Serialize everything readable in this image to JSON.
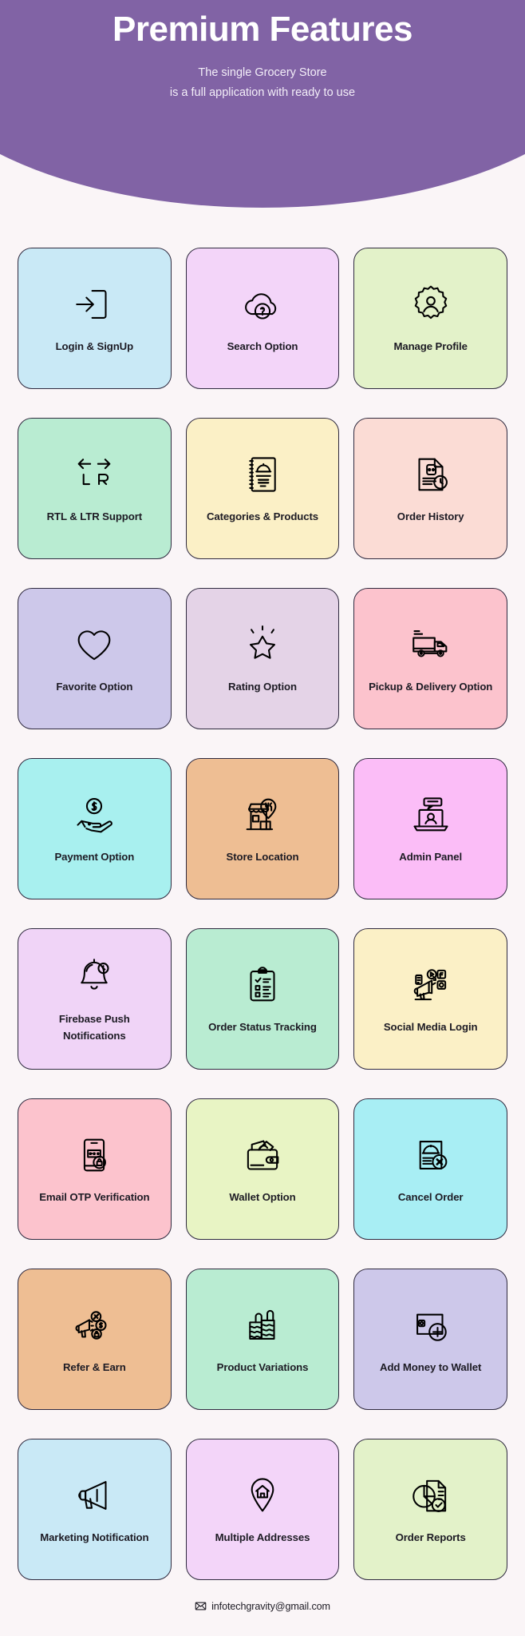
{
  "header": {
    "title": "Premium Features",
    "subtitle_line1": "The single Grocery Store",
    "subtitle_line2": "is a full application with ready to use",
    "background_color": "#8163a5",
    "text_color": "#ffffff"
  },
  "page": {
    "background_color": "#faf5f7",
    "card_border_color": "#2f2a3f",
    "icon_color": "#000000"
  },
  "features": [
    {
      "label": "Login & SignUp",
      "icon": "login-arrow-door-icon",
      "color": "#c9e9f6"
    },
    {
      "label": "Search Option",
      "icon": "cloud-search-icon",
      "color": "#f3d5f9"
    },
    {
      "label": "Manage Profile",
      "icon": "gear-user-profile-icon",
      "color": "#e3f2c9"
    },
    {
      "label": "RTL & LTR Support",
      "icon": "left-right-arrows-icon",
      "color": "#b9ecd2"
    },
    {
      "label": "Categories & Products",
      "icon": "menu-book-cloche-icon",
      "color": "#fbf0c6"
    },
    {
      "label": "Order History",
      "icon": "document-clock-history-icon",
      "color": "#fbdcd5"
    },
    {
      "label": "Favorite Option",
      "icon": "heart-icon",
      "color": "#cdc8ea"
    },
    {
      "label": "Rating Option",
      "icon": "star-sparkle-icon",
      "color": "#e4d3e7"
    },
    {
      "label": "Pickup & Delivery Option",
      "icon": "delivery-truck-icon",
      "color": "#fcc3cd"
    },
    {
      "label": "Payment Option",
      "icon": "hand-dollar-coin-icon",
      "color": "#a8f0ef"
    },
    {
      "label": "Store Location",
      "icon": "store-map-pin-icon",
      "color": "#eebe93"
    },
    {
      "label": "Admin Panel",
      "icon": "laptop-admin-user-icon",
      "color": "#fbbdf7"
    },
    {
      "label": "Firebase  Push Notifications",
      "icon": "bell-notification-icon",
      "color": "#f0d4f7"
    },
    {
      "label": "Order Status Tracking",
      "icon": "clipboard-checklist-icon",
      "color": "#b9ecd2"
    },
    {
      "label": "Social Media Login",
      "icon": "megaphone-social-icons",
      "color": "#fbf0c6"
    },
    {
      "label": "Email OTP Verification",
      "icon": "phone-otp-lock-icon",
      "color": "#fcc3cd"
    },
    {
      "label": "Wallet Option",
      "icon": "wallet-cash-icon",
      "color": "#e8f4c4"
    },
    {
      "label": "Cancel Order",
      "icon": "order-cancel-cross-icon",
      "color": "#a8eef4"
    },
    {
      "label": "Refer & Earn",
      "icon": "megaphone-reward-icon",
      "color": "#eebe93"
    },
    {
      "label": "Product Variations",
      "icon": "product-variations-icon",
      "color": "#b9ecd2"
    },
    {
      "label": "Add Money to Wallet",
      "icon": "wallet-plus-icon",
      "color": "#cdc8ea"
    },
    {
      "label": "Marketing Notification",
      "icon": "megaphone-icon",
      "color": "#c9e9f6"
    },
    {
      "label": "Multiple Addresses",
      "icon": "home-map-pin-icon",
      "color": "#f3d5f9"
    },
    {
      "label": "Order Reports",
      "icon": "pie-chart-report-icon",
      "color": "#e3f2c9"
    }
  ],
  "footer": {
    "email": "infotechgravity@gmail.com",
    "icon": "envelope-icon"
  }
}
